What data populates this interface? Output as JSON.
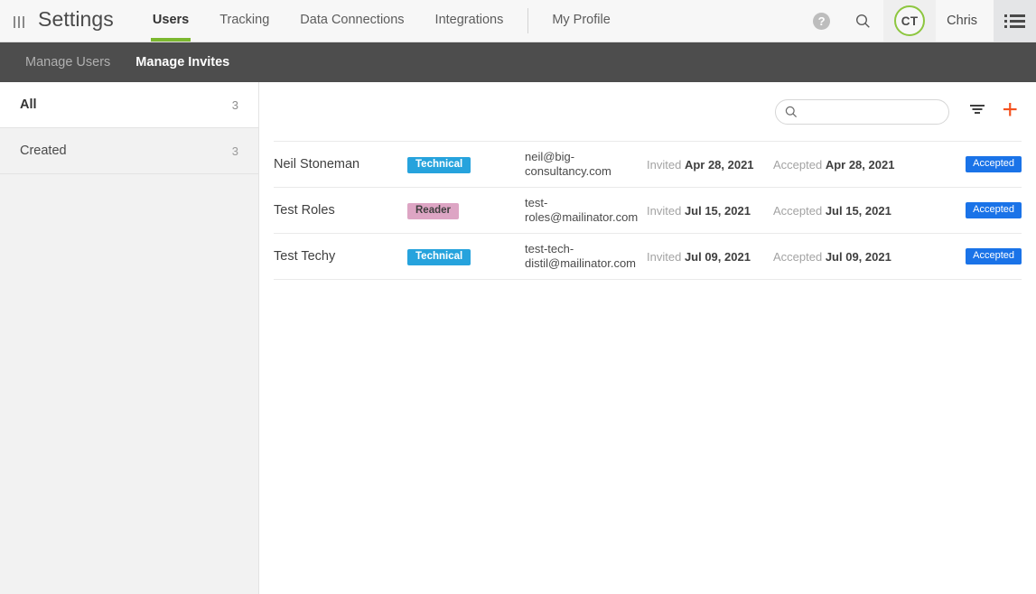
{
  "header": {
    "grip_icon": "grip-vertical-icon",
    "app_title": "Settings",
    "tabs": [
      {
        "label": "Users",
        "active": true
      },
      {
        "label": "Tracking",
        "active": false
      },
      {
        "label": "Data Connections",
        "active": false
      },
      {
        "label": "Integrations",
        "active": false
      }
    ],
    "profile_tab": "My Profile",
    "help_icon": "help-icon",
    "help_glyph": "?",
    "search_icon": "search-icon",
    "avatar_initials": "CT",
    "user_name": "Chris",
    "menu_icon": "list-menu-icon",
    "accent_green": "#7cb82f"
  },
  "subnav": {
    "items": [
      {
        "label": "Manage Users",
        "active": false
      },
      {
        "label": "Manage Invites",
        "active": true
      }
    ]
  },
  "sidebar": {
    "items": [
      {
        "label": "All",
        "count": "3",
        "active": true
      },
      {
        "label": "Created",
        "count": "3",
        "active": false
      }
    ]
  },
  "toolbar": {
    "search_placeholder": "",
    "search_value": "",
    "search_icon": "search-icon",
    "filter_icon": "filter-icon",
    "add_icon": "plus-icon",
    "add_color": "#f4511e"
  },
  "table": {
    "labels": {
      "invited": "Invited",
      "accepted": "Accepted"
    },
    "rows": [
      {
        "name": "Neil Stoneman",
        "role": "Technical",
        "role_style": "technical",
        "email": "neil@big-consultancy.com",
        "invited_label": "Invited",
        "invited_date": "Apr 28, 2021",
        "accepted_label": "Accepted",
        "accepted_date": "Apr 28, 2021",
        "status": "Accepted"
      },
      {
        "name": "Test Roles",
        "role": "Reader",
        "role_style": "reader",
        "email": "test-roles@mailinator.com",
        "invited_label": "Invited",
        "invited_date": "Jul 15, 2021",
        "accepted_label": "Accepted",
        "accepted_date": "Jul 15, 2021",
        "status": "Accepted"
      },
      {
        "name": "Test Techy",
        "role": "Technical",
        "role_style": "technical",
        "email": "test-tech-distil@mailinator.com",
        "invited_label": "Invited",
        "invited_date": "Jul 09, 2021",
        "accepted_label": "Accepted",
        "accepted_date": "Jul 09, 2021",
        "status": "Accepted"
      }
    ]
  },
  "colors": {
    "tag_technical": "#26a3dd",
    "tag_reader": "#dda5c4",
    "badge_accepted": "#1a73e8",
    "subnav_bg": "#4d4d4d"
  }
}
